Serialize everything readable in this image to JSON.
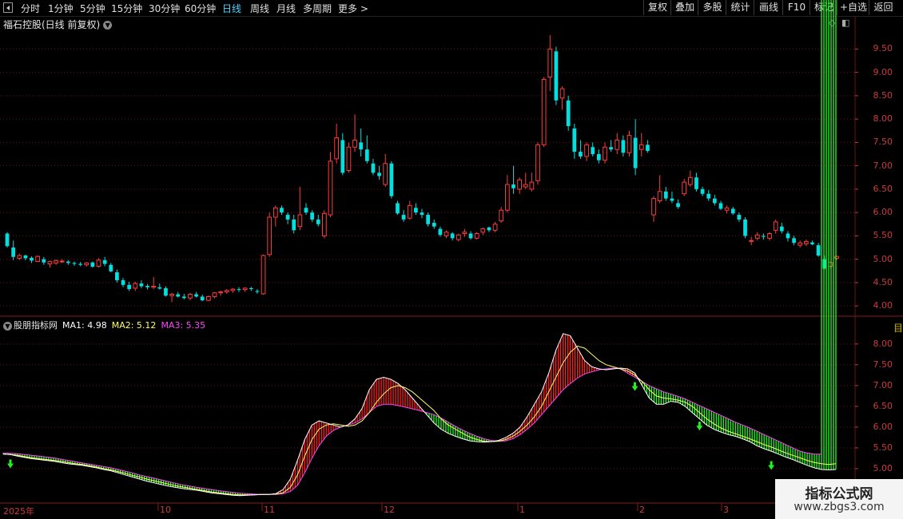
{
  "toolbar": {
    "periods": [
      "分时",
      "1分钟",
      "5分钟",
      "15分钟",
      "30分钟",
      "60分钟",
      "日线",
      "周线",
      "月线",
      "多周期",
      "更多 >"
    ],
    "active_period": "日线",
    "right_buttons": [
      "复权",
      "叠加",
      "多股",
      "统计",
      "画线",
      "F10",
      "标记",
      "+自选",
      "返回"
    ]
  },
  "main_chart": {
    "title": "福石控股(日线 前复权)",
    "y_ticks": [
      "9.50",
      "9.00",
      "8.50",
      "8.00",
      "7.50",
      "7.00",
      "6.50",
      "6.00",
      "5.50",
      "5.00",
      "4.50",
      "4.00"
    ]
  },
  "indicator": {
    "name": "股朋指标网",
    "ma1_label": "MA1: 4.98",
    "ma2_label": "MA2: 5.12",
    "ma3_label": "MA3: 5.35",
    "y_ticks": [
      "8.00",
      "7.50",
      "7.00",
      "6.50",
      "6.00",
      "5.50",
      "5.00"
    ]
  },
  "x_labels": [
    "2025年",
    "10",
    "11",
    "12",
    "1",
    "2",
    "3"
  ],
  "watermark": {
    "title": "指标公式网",
    "url": "www.zbgs3.com"
  },
  "colors": {
    "up": "#ff3c3c",
    "down": "#00e0e0",
    "grid": "#6e1414",
    "ma1": "#ffffff",
    "ma2": "#ffff66",
    "ma3": "#ff44ff",
    "red_fill": "#ff2020",
    "green_fill": "#22ff22"
  },
  "chart_data": [
    {
      "type": "candlestick",
      "title": "福石控股(日线 前复权)",
      "ylim": [
        3.9,
        9.9
      ],
      "x_labels": [
        "2025年",
        "10",
        "11",
        "12",
        "1",
        "2",
        "3"
      ],
      "ohlc": [
        [
          5.55,
          5.58,
          5.25,
          5.28
        ],
        [
          5.25,
          5.4,
          4.98,
          5.05
        ],
        [
          5.02,
          5.12,
          4.98,
          5.08
        ],
        [
          5.08,
          5.1,
          4.98,
          5.02
        ],
        [
          5.03,
          5.06,
          4.92,
          4.97
        ],
        [
          4.95,
          5.08,
          4.94,
          5.06
        ],
        [
          5.0,
          5.05,
          4.88,
          4.93
        ],
        [
          4.9,
          4.97,
          4.82,
          4.95
        ],
        [
          4.92,
          5.0,
          4.88,
          4.97
        ],
        [
          4.96,
          5.0,
          4.92,
          4.96
        ],
        [
          4.95,
          4.98,
          4.88,
          4.92
        ],
        [
          4.92,
          4.95,
          4.86,
          4.9
        ],
        [
          4.9,
          4.94,
          4.85,
          4.88
        ],
        [
          4.88,
          4.94,
          4.84,
          4.92
        ],
        [
          4.93,
          4.95,
          4.82,
          4.84
        ],
        [
          4.85,
          5.02,
          4.82,
          4.98
        ],
        [
          4.98,
          5.05,
          4.85,
          4.9
        ],
        [
          4.88,
          4.92,
          4.72,
          4.74
        ],
        [
          4.72,
          4.78,
          4.5,
          4.55
        ],
        [
          4.55,
          4.6,
          4.4,
          4.45
        ],
        [
          4.45,
          4.52,
          4.32,
          4.36
        ],
        [
          4.38,
          4.52,
          4.32,
          4.48
        ],
        [
          4.48,
          4.55,
          4.38,
          4.42
        ],
        [
          4.43,
          4.47,
          4.35,
          4.4
        ],
        [
          4.4,
          4.62,
          4.36,
          4.42
        ],
        [
          4.4,
          4.48,
          4.35,
          4.37
        ],
        [
          4.38,
          4.42,
          4.2,
          4.22
        ],
        [
          4.22,
          4.28,
          4.08,
          4.25
        ],
        [
          4.25,
          4.3,
          4.18,
          4.2
        ],
        [
          4.2,
          4.26,
          4.14,
          4.17
        ],
        [
          4.17,
          4.28,
          4.12,
          4.25
        ],
        [
          4.25,
          4.3,
          4.18,
          4.2
        ],
        [
          4.2,
          4.24,
          4.1,
          4.12
        ],
        [
          4.12,
          4.22,
          4.1,
          4.2
        ],
        [
          4.2,
          4.3,
          4.16,
          4.28
        ],
        [
          4.28,
          4.33,
          4.22,
          4.3
        ],
        [
          4.3,
          4.36,
          4.26,
          4.33
        ],
        [
          4.33,
          4.38,
          4.28,
          4.36
        ],
        [
          4.36,
          4.4,
          4.3,
          4.35
        ],
        [
          4.35,
          4.4,
          4.3,
          4.38
        ],
        [
          4.38,
          4.41,
          4.32,
          4.36
        ],
        [
          4.32,
          4.36,
          4.26,
          4.3
        ],
        [
          4.26,
          5.1,
          4.24,
          5.08
        ],
        [
          5.1,
          6.0,
          5.05,
          5.9
        ],
        [
          5.9,
          6.15,
          5.7,
          6.1
        ],
        [
          6.1,
          6.15,
          5.95,
          6.0
        ],
        [
          5.95,
          6.0,
          5.75,
          5.85
        ],
        [
          5.85,
          5.95,
          5.55,
          5.62
        ],
        [
          5.7,
          6.55,
          5.62,
          5.95
        ],
        [
          6.1,
          6.2,
          5.95,
          6.0
        ],
        [
          6.0,
          6.05,
          5.8,
          5.85
        ],
        [
          5.85,
          5.95,
          5.7,
          5.75
        ],
        [
          5.5,
          6.05,
          5.45,
          5.98
        ],
        [
          5.95,
          7.3,
          5.9,
          7.1
        ],
        [
          7.15,
          7.9,
          7.05,
          7.6
        ],
        [
          7.55,
          7.7,
          6.8,
          6.85
        ],
        [
          6.9,
          7.5,
          6.85,
          7.4
        ],
        [
          7.4,
          8.1,
          7.3,
          7.55
        ],
        [
          7.5,
          7.8,
          7.2,
          7.35
        ],
        [
          7.35,
          7.65,
          7.05,
          7.1
        ],
        [
          7.05,
          7.15,
          6.8,
          6.85
        ],
        [
          6.85,
          7.0,
          6.7,
          6.78
        ],
        [
          6.6,
          7.25,
          6.55,
          7.05
        ],
        [
          7.05,
          7.1,
          6.3,
          6.35
        ],
        [
          6.2,
          6.25,
          5.95,
          5.98
        ],
        [
          5.95,
          6.05,
          5.8,
          5.85
        ],
        [
          5.88,
          6.25,
          5.85,
          6.15
        ],
        [
          6.1,
          6.2,
          5.95,
          6.0
        ],
        [
          6.0,
          6.08,
          5.88,
          5.95
        ],
        [
          5.95,
          6.0,
          5.7,
          5.75
        ],
        [
          5.78,
          5.85,
          5.65,
          5.7
        ],
        [
          5.65,
          5.7,
          5.48,
          5.52
        ],
        [
          5.5,
          5.62,
          5.45,
          5.58
        ],
        [
          5.55,
          5.58,
          5.4,
          5.45
        ],
        [
          5.42,
          5.55,
          5.38,
          5.52
        ],
        [
          5.55,
          5.65,
          5.48,
          5.58
        ],
        [
          5.55,
          5.6,
          5.42,
          5.45
        ],
        [
          5.45,
          5.58,
          5.42,
          5.55
        ],
        [
          5.58,
          5.68,
          5.52,
          5.65
        ],
        [
          5.68,
          5.7,
          5.58,
          5.62
        ],
        [
          5.62,
          5.8,
          5.58,
          5.75
        ],
        [
          5.82,
          6.12,
          5.78,
          6.05
        ],
        [
          6.05,
          6.8,
          6.0,
          6.6
        ],
        [
          6.6,
          7.0,
          6.4,
          6.52
        ],
        [
          6.5,
          6.75,
          6.4,
          6.7
        ],
        [
          6.55,
          6.85,
          6.5,
          6.6
        ],
        [
          6.5,
          6.85,
          6.45,
          6.65
        ],
        [
          6.68,
          7.5,
          6.6,
          7.45
        ],
        [
          7.45,
          8.9,
          7.4,
          8.85
        ],
        [
          8.9,
          9.8,
          8.6,
          9.5
        ],
        [
          9.45,
          9.55,
          8.3,
          8.4
        ],
        [
          8.45,
          8.7,
          8.2,
          8.65
        ],
        [
          8.4,
          8.5,
          7.75,
          7.85
        ],
        [
          7.8,
          7.9,
          7.15,
          7.3
        ],
        [
          7.3,
          7.55,
          7.15,
          7.2
        ],
        [
          7.2,
          7.5,
          7.1,
          7.45
        ],
        [
          7.4,
          7.5,
          7.2,
          7.25
        ],
        [
          7.25,
          7.35,
          7.05,
          7.12
        ],
        [
          7.12,
          7.5,
          7.05,
          7.4
        ],
        [
          7.4,
          7.55,
          7.3,
          7.35
        ],
        [
          7.35,
          7.7,
          7.25,
          7.55
        ],
        [
          7.55,
          7.65,
          7.2,
          7.28
        ],
        [
          7.28,
          7.75,
          7.2,
          7.65
        ],
        [
          7.6,
          8.0,
          6.8,
          6.95
        ],
        [
          7.35,
          7.7,
          7.2,
          7.45
        ],
        [
          7.45,
          7.55,
          7.28,
          7.32
        ],
        [
          5.95,
          6.35,
          5.8,
          6.3
        ],
        [
          6.25,
          6.8,
          6.2,
          6.45
        ],
        [
          6.45,
          6.55,
          6.25,
          6.3
        ],
        [
          6.3,
          6.45,
          6.2,
          6.25
        ],
        [
          6.2,
          6.28,
          6.08,
          6.12
        ],
        [
          6.4,
          6.72,
          6.35,
          6.65
        ],
        [
          6.6,
          6.9,
          6.55,
          6.75
        ],
        [
          6.75,
          6.85,
          6.45,
          6.5
        ],
        [
          6.5,
          6.55,
          6.35,
          6.4
        ],
        [
          6.4,
          6.48,
          6.25,
          6.3
        ],
        [
          6.3,
          6.38,
          6.15,
          6.2
        ],
        [
          6.2,
          6.25,
          6.05,
          6.08
        ],
        [
          6.05,
          6.15,
          5.98,
          6.1
        ],
        [
          6.08,
          6.12,
          5.95,
          5.98
        ],
        [
          5.95,
          6.0,
          5.8,
          5.85
        ],
        [
          5.85,
          5.9,
          5.45,
          5.5
        ],
        [
          5.4,
          5.48,
          5.3,
          5.4
        ],
        [
          5.45,
          5.58,
          5.4,
          5.52
        ],
        [
          5.5,
          5.55,
          5.42,
          5.48
        ],
        [
          5.45,
          5.58,
          5.4,
          5.55
        ],
        [
          5.62,
          5.85,
          5.55,
          5.8
        ],
        [
          5.7,
          5.78,
          5.55,
          5.6
        ],
        [
          5.55,
          5.6,
          5.38,
          5.45
        ],
        [
          5.45,
          5.5,
          5.3,
          5.35
        ],
        [
          5.3,
          5.4,
          5.25,
          5.35
        ],
        [
          5.33,
          5.42,
          5.28,
          5.38
        ],
        [
          5.36,
          5.4,
          5.3,
          5.32
        ],
        [
          5.3,
          5.35,
          5.05,
          5.08
        ],
        [
          5.0,
          5.08,
          4.78,
          4.8
        ],
        [
          4.85,
          4.95,
          4.8,
          4.93
        ],
        [
          5.02,
          5.08,
          4.98,
          5.06
        ]
      ]
    },
    {
      "type": "line",
      "title": "股朋指标网",
      "ylim": [
        4.25,
        8.4
      ],
      "series": [
        {
          "name": "MA1",
          "values": [
            5.35,
            5.34,
            5.3,
            5.27,
            5.24,
            5.22,
            5.2,
            5.18,
            5.15,
            5.12,
            5.1,
            5.08,
            5.05,
            5.02,
            4.98,
            4.95,
            4.9,
            4.85,
            4.8,
            4.75,
            4.7,
            4.66,
            4.62,
            4.58,
            4.55,
            4.52,
            4.5,
            4.48,
            4.45,
            4.42,
            4.4,
            4.38,
            4.36,
            4.35,
            4.36,
            4.37,
            4.38,
            4.38,
            4.4,
            4.5,
            4.75,
            5.2,
            5.7,
            6.05,
            6.15,
            6.1,
            6.05,
            6.0,
            6.05,
            6.2,
            6.45,
            6.9,
            7.15,
            7.2,
            7.15,
            7.05,
            6.9,
            6.7,
            6.5,
            6.3,
            6.1,
            5.95,
            5.85,
            5.78,
            5.72,
            5.67,
            5.65,
            5.64,
            5.65,
            5.68,
            5.75,
            5.85,
            6.0,
            6.25,
            6.55,
            6.85,
            7.3,
            7.85,
            8.25,
            8.2,
            7.9,
            7.6,
            7.45,
            7.4,
            7.38,
            7.4,
            7.42,
            7.4,
            7.3,
            7.0,
            6.7,
            6.55,
            6.55,
            6.62,
            6.6,
            6.5,
            6.35,
            6.2,
            6.05,
            5.95,
            5.88,
            5.82,
            5.78,
            5.72,
            5.65,
            5.55,
            5.48,
            5.42,
            5.35,
            5.28,
            5.22,
            5.15,
            5.08,
            5.02,
            4.98,
            4.97,
            4.98
          ]
        },
        {
          "name": "MA2",
          "values": [
            5.35,
            5.34,
            5.32,
            5.29,
            5.26,
            5.24,
            5.22,
            5.2,
            5.18,
            5.15,
            5.12,
            5.1,
            5.07,
            5.04,
            5.0,
            4.97,
            4.93,
            4.89,
            4.84,
            4.8,
            4.75,
            4.71,
            4.67,
            4.63,
            4.59,
            4.56,
            4.53,
            4.5,
            4.47,
            4.44,
            4.42,
            4.4,
            4.38,
            4.37,
            4.37,
            4.37,
            4.38,
            4.38,
            4.39,
            4.42,
            4.55,
            4.85,
            5.3,
            5.7,
            5.95,
            6.05,
            6.08,
            6.05,
            6.02,
            6.05,
            6.15,
            6.35,
            6.6,
            6.8,
            6.95,
            7.0,
            6.95,
            6.85,
            6.7,
            6.55,
            6.4,
            6.2,
            6.05,
            5.95,
            5.85,
            5.76,
            5.7,
            5.66,
            5.65,
            5.66,
            5.7,
            5.78,
            5.9,
            6.05,
            6.25,
            6.5,
            6.85,
            7.2,
            7.55,
            7.8,
            7.95,
            7.9,
            7.75,
            7.6,
            7.5,
            7.45,
            7.4,
            7.35,
            7.25,
            7.1,
            6.9,
            6.75,
            6.7,
            6.68,
            6.65,
            6.6,
            6.5,
            6.35,
            6.2,
            6.08,
            5.98,
            5.9,
            5.84,
            5.78,
            5.72,
            5.65,
            5.58,
            5.52,
            5.45,
            5.38,
            5.32,
            5.26,
            5.2,
            5.15,
            5.12,
            5.1,
            5.12
          ]
        },
        {
          "name": "MA3",
          "values": [
            5.38,
            5.37,
            5.36,
            5.34,
            5.32,
            5.3,
            5.28,
            5.26,
            5.23,
            5.2,
            5.17,
            5.14,
            5.11,
            5.08,
            5.05,
            5.02,
            4.98,
            4.94,
            4.9,
            4.85,
            4.81,
            4.77,
            4.73,
            4.69,
            4.65,
            4.61,
            4.58,
            4.55,
            4.52,
            4.5,
            4.47,
            4.45,
            4.43,
            4.41,
            4.4,
            4.39,
            4.38,
            4.38,
            4.38,
            4.4,
            4.45,
            4.6,
            4.9,
            5.25,
            5.55,
            5.78,
            5.92,
            6.0,
            6.05,
            6.1,
            6.2,
            6.35,
            6.5,
            6.55,
            6.55,
            6.52,
            6.48,
            6.44,
            6.4,
            6.35,
            6.3,
            6.22,
            6.12,
            6.02,
            5.93,
            5.85,
            5.78,
            5.72,
            5.68,
            5.66,
            5.67,
            5.72,
            5.82,
            5.95,
            6.1,
            6.3,
            6.5,
            6.7,
            6.9,
            7.05,
            7.18,
            7.28,
            7.33,
            7.38,
            7.4,
            7.42,
            7.4,
            7.3,
            7.2,
            7.1,
            7.0,
            6.92,
            6.85,
            6.8,
            6.74,
            6.68,
            6.6,
            6.52,
            6.44,
            6.36,
            6.28,
            6.2,
            6.12,
            6.05,
            5.98,
            5.9,
            5.82,
            5.74,
            5.66,
            5.58,
            5.5,
            5.42,
            5.38,
            5.35,
            5.35
          ]
        }
      ]
    }
  ]
}
